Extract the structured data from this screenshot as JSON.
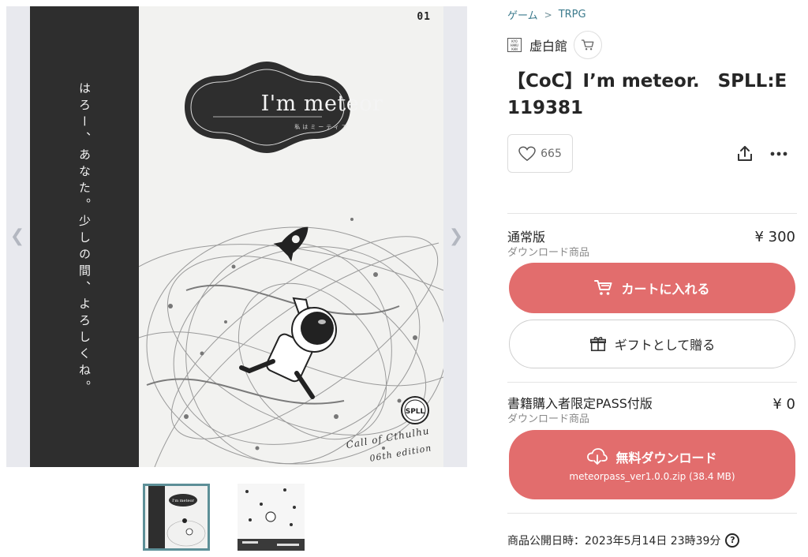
{
  "gallery": {
    "prev_icon": "chevron-left-icon",
    "next_icon": "chevron-right-icon",
    "cover": {
      "number": "01",
      "title": "I'm meteor",
      "subtitle": "私はミーティア",
      "tagline": "はろー、あなた。少しの間、よろしくね。",
      "footer_line1": "Call of Cthulhu",
      "footer_line2": "06th edition",
      "badge": "SPLL"
    },
    "thumbnails": [
      {
        "label": "I'm meteor",
        "selected": true
      },
      {
        "label": "",
        "selected": false
      }
    ]
  },
  "breadcrumb": {
    "items": [
      "ゲーム",
      "TRPG"
    ],
    "separator": ">"
  },
  "shop": {
    "logo_text": [
      "KYO",
      "HAKU",
      "KAN"
    ],
    "name": "虚白館",
    "cart_icon": "cart-icon"
  },
  "product": {
    "title": "【CoC】I’m meteor.　SPLL:E119381",
    "likes": "665"
  },
  "variants": [
    {
      "name": "通常版",
      "type": "ダウンロード商品",
      "price": "¥ 300",
      "button_label": "カートに入れる",
      "gift_label": "ギフトとして贈る"
    },
    {
      "name": "書籍購入者限定PASS付版",
      "type": "ダウンロード商品",
      "price": "¥ 0",
      "button_label": "無料ダウンロード",
      "file": "meteorpass_ver1.0.0.zip (38.4 MB)"
    }
  ],
  "published": {
    "label": "商品公開日時：2023年5月14日 23時39分",
    "help_icon": "?"
  },
  "colors": {
    "accent": "#e26d6d",
    "link": "#3b7a8c",
    "cover_band": "#2e2e2e",
    "thumb_border": "#5d8f97"
  }
}
